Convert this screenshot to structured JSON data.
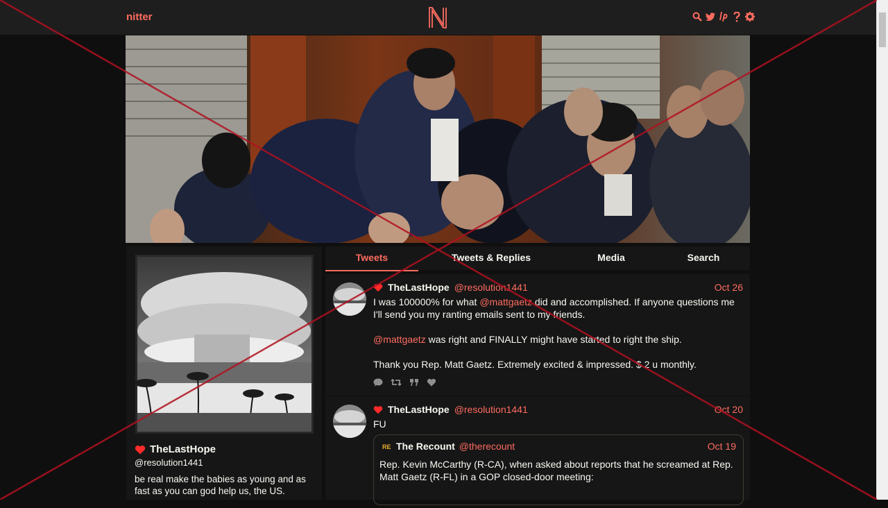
{
  "nav": {
    "brand": "nitter",
    "logo": "N",
    "icons": [
      "search-icon",
      "twitter-bird-icon",
      "lp-icon",
      "help-icon",
      "settings-gear-icon"
    ]
  },
  "profile": {
    "name": "TheLastHope",
    "handle": "@resolution1441",
    "bio": "be real make the babies as young and as fast as you can god help us, the US."
  },
  "tabs": [
    "Tweets",
    "Tweets & Replies",
    "Media",
    "Search"
  ],
  "tweets": [
    {
      "name": "TheLastHope",
      "handle": "@resolution1441",
      "date": "Oct 26",
      "line1_mention": "@mattgaetz",
      "line1_pre": "I was 100000% for what ",
      "line1_post": " did and accomplished. If anyone questions me I'll send you my ranting emails sent to my friends.",
      "line2_mention": "@mattgaetz",
      "line2_post": " was right and FINALLY might have started to right the ship.",
      "line3": "Thank you Rep. Matt Gaetz. Extremely excited & impressed. $ 2 u monthly."
    },
    {
      "name": "TheLastHope",
      "handle": "@resolution1441",
      "date": "Oct 20",
      "text": "FU",
      "quote": {
        "name": "The Recount",
        "handle": "@therecount",
        "date": "Oct 19",
        "text": "Rep. Kevin McCarthy (R-CA), when asked about reports that he screamed at Rep. Matt Gaetz (R-FL) in a GOP closed-door meeting:"
      }
    }
  ],
  "colors": {
    "accent": "#ff6c60",
    "background": "#0f0f0f",
    "panel": "#161616",
    "navbar": "#1e1e1e",
    "text": "#f8f8f2",
    "heart": "#ff2b2b",
    "overlay_cross": "#b01020"
  }
}
